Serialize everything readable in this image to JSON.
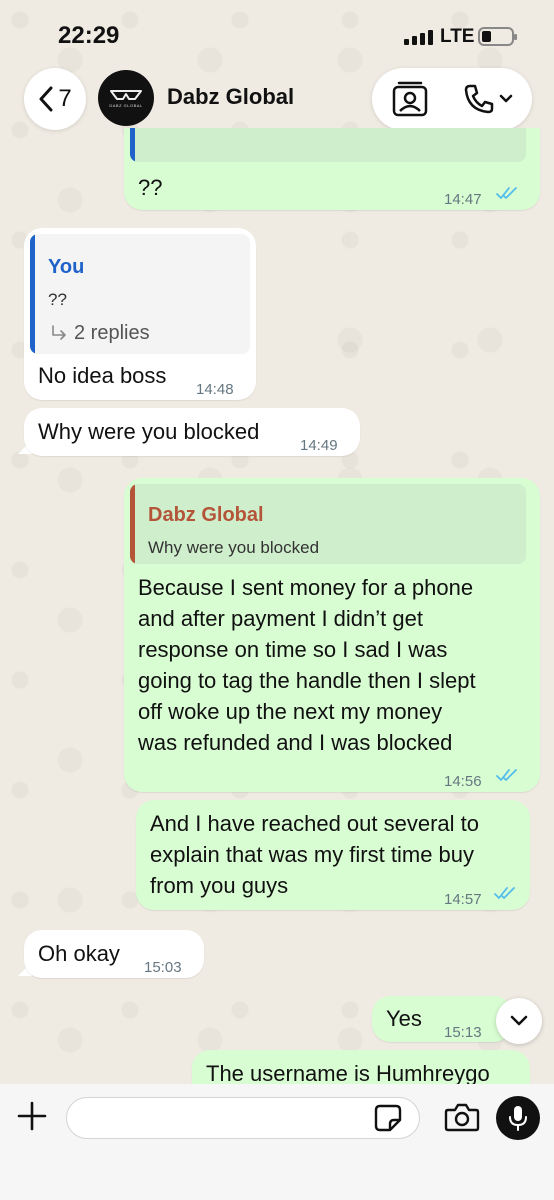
{
  "status_bar": {
    "time": "22:29",
    "network": "LTE"
  },
  "header": {
    "back_count": "7",
    "contact_name": "Dabz Global",
    "avatar_text": "DABZ GLOBAL"
  },
  "messages": [
    {
      "direction": "out",
      "text": "??",
      "time": "14:47",
      "status": "read"
    },
    {
      "direction": "in",
      "quote_author": "You",
      "quote_text": "??",
      "replies": "2 replies",
      "text": "No idea boss",
      "time": "14:48"
    },
    {
      "direction": "in",
      "text": "Why were you blocked",
      "time": "14:49"
    },
    {
      "direction": "out",
      "quote_author": "Dabz Global",
      "quote_text": "Why were you blocked",
      "lines": [
        "Because I sent money for a phone",
        "and after payment I didn’t get",
        "response on time so I sad I was",
        "going to tag the handle then I slept",
        "off woke up the next my money",
        "was refunded and I was blocked"
      ],
      "time": "14:56",
      "status": "read"
    },
    {
      "direction": "out",
      "lines": [
        "And I have reached out several to",
        "explain that was my first time buy",
        "from you guys"
      ],
      "time": "14:57",
      "status": "read"
    },
    {
      "direction": "in",
      "text": "Oh okay",
      "time": "15:03"
    },
    {
      "direction": "out",
      "text": "Yes",
      "time": "15:13"
    },
    {
      "direction": "out",
      "text": "The username is Humhreygo"
    }
  ],
  "composer": {
    "value": "",
    "placeholder": ""
  },
  "colors": {
    "incoming": "#ffffff",
    "outgoing": "#d9fdd3",
    "quote_you": "#1f62c9",
    "quote_contact": "#b4553a",
    "read_ticks": "#53bdeb"
  },
  "icons": [
    "back-chevron-icon",
    "contact-card-icon",
    "phone-icon",
    "chevron-down-icon",
    "plus-icon",
    "sticker-icon",
    "camera-icon",
    "microphone-icon",
    "double-check-icon",
    "reply-arrow-icon"
  ]
}
